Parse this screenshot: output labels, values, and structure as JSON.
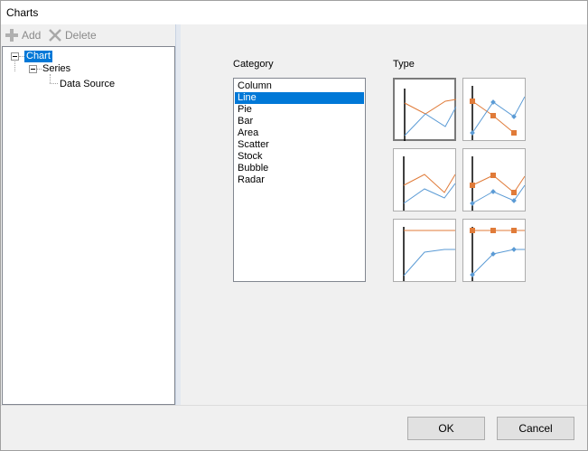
{
  "window": {
    "title": "Charts"
  },
  "toolbar": {
    "add_label": "Add",
    "delete_label": "Delete",
    "add_icon": "plus-icon",
    "delete_icon": "x-icon"
  },
  "tree": {
    "nodes": [
      {
        "label": "Chart",
        "selected": true
      },
      {
        "label": "Series"
      },
      {
        "label": "Data Source"
      }
    ]
  },
  "category": {
    "label": "Category",
    "items": [
      "Column",
      "Line",
      "Pie",
      "Bar",
      "Area",
      "Scatter",
      "Stock",
      "Bubble",
      "Radar"
    ],
    "selected": "Line"
  },
  "type": {
    "label": "Type",
    "options": [
      "line",
      "line-markers",
      "stacked-line",
      "stacked-line-markers",
      "100-stacked-line",
      "100-stacked-line-markers"
    ],
    "selected": "line"
  },
  "colors": {
    "accent": "#0078d7",
    "series_orange": "#e07b39",
    "series_blue": "#5b9bd5"
  },
  "buttons": {
    "ok": "OK",
    "cancel": "Cancel"
  }
}
